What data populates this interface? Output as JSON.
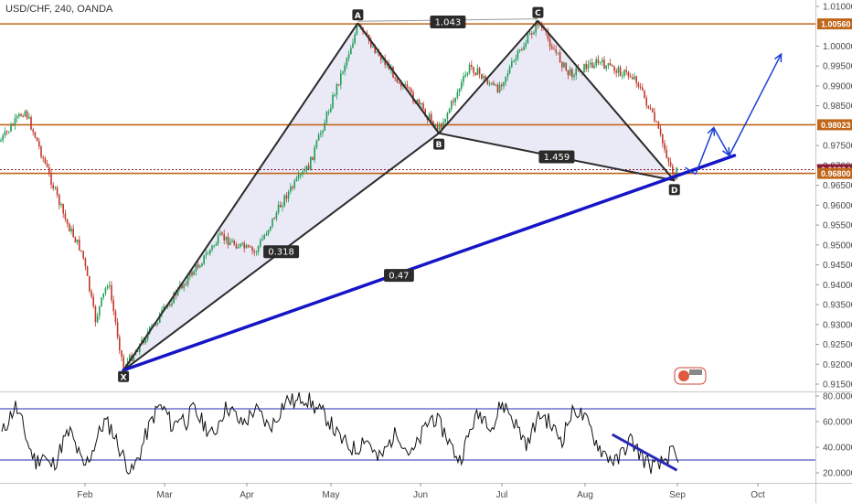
{
  "title": "USD/CHF, 240, OANDA",
  "colors": {
    "pattern_line": "#2b2b2b",
    "pattern_fill": "#d8d8f0",
    "trendline": "#1515c8",
    "projection": "#1a3fd6",
    "resistance": "#c0661a",
    "current": "#8b1a3a",
    "candle_up": "#1f9d55",
    "candle_down": "#c0392b",
    "rsi_line": "#111111",
    "rsi_levels": "#2a2ab8"
  },
  "chart_data": [
    {
      "type": "candlestick",
      "title": "USD/CHF, 240, OANDA",
      "x_tick_labels": [
        "Feb",
        "Mar",
        "Apr",
        "May",
        "Jun",
        "Jul",
        "Aug",
        "Sep",
        "Oct"
      ],
      "y_tick_labels": [
        "1.01000",
        "1.00000",
        "0.99500",
        "0.99000",
        "0.98500",
        "0.97500",
        "0.97000",
        "0.96500",
        "0.96000",
        "0.95500",
        "0.95000",
        "0.94500",
        "0.94000",
        "0.93500",
        "0.93000",
        "0.92500",
        "0.92000",
        "0.91500"
      ],
      "ylim": [
        0.9135,
        1.0113
      ],
      "y_ticks_values": [
        1.01,
        1.0,
        0.995,
        0.99,
        0.985,
        0.975,
        0.97,
        0.965,
        0.96,
        0.955,
        0.95,
        0.945,
        0.94,
        0.935,
        0.93,
        0.925,
        0.92,
        0.915
      ],
      "horizontal_levels": [
        {
          "label": "1.00560",
          "value": 1.0056,
          "color": "#c0661a"
        },
        {
          "label": "0.98023",
          "value": 0.98023,
          "color": "#c0661a"
        },
        {
          "label": "0.96894",
          "value": 0.96894,
          "color": "#8b1a3a"
        },
        {
          "label": "0.96800",
          "value": 0.968,
          "color": "#c0661a"
        }
      ],
      "pattern_points": [
        {
          "name": "X",
          "date": "2017-02-16",
          "price": 0.9185
        },
        {
          "name": "A",
          "date": "2017-05-10",
          "price": 1.0058
        },
        {
          "name": "B",
          "date": "2017-06-08",
          "price": 0.9781
        },
        {
          "name": "C",
          "date": "2017-07-14",
          "price": 1.0064
        },
        {
          "name": "D",
          "date": "2017-08-31",
          "price": 0.9662
        }
      ],
      "ratios": [
        {
          "label": "1.043",
          "between": [
            "A",
            "C"
          ]
        },
        {
          "label": "0.318",
          "between": [
            "X",
            "B"
          ]
        },
        {
          "label": "1.459",
          "between": [
            "B",
            "D"
          ]
        },
        {
          "label": "0.47",
          "between": [
            "X",
            "D"
          ]
        }
      ],
      "trendline": {
        "from": {
          "date": "2017-02-16",
          "price": 0.9185
        },
        "to": {
          "date": "2017-09-23",
          "price": 0.9725
        }
      },
      "projection_path": [
        {
          "date": "2017-09-04",
          "price": 0.9695
        },
        {
          "date": "2017-09-08",
          "price": 0.9678
        },
        {
          "date": "2017-09-15",
          "price": 0.9795
        },
        {
          "date": "2017-09-21",
          "price": 0.9725
        },
        {
          "date": "2017-10-10",
          "price": 0.998
        }
      ]
    },
    {
      "type": "line",
      "title": "",
      "y_tick_labels": [
        "80.0000",
        "60.0000",
        "40.0000",
        "20.0000"
      ],
      "ylim": [
        13,
        85
      ],
      "levels": [
        70,
        30
      ],
      "series": [
        {
          "values": [
            50,
            62,
            72,
            58,
            40,
            28,
            35,
            25,
            30,
            45,
            52,
            38,
            24,
            34,
            48,
            60,
            55,
            42,
            30,
            20,
            32,
            48,
            62,
            72,
            68,
            55,
            65,
            60,
            70,
            62,
            55,
            48,
            64,
            72,
            66,
            58,
            62,
            70,
            64,
            56,
            60,
            72,
            78,
            74,
            80,
            76,
            70,
            66,
            60,
            50,
            44,
            40,
            38,
            48,
            42,
            30,
            36,
            46,
            52,
            40,
            34,
            44,
            56,
            64,
            58,
            50,
            38,
            30,
            44,
            60,
            66,
            62,
            56,
            74,
            70,
            60,
            50,
            42,
            58,
            66,
            60,
            52,
            46,
            62,
            70,
            64,
            56,
            44,
            36,
            32,
            28,
            38,
            46,
            38,
            30,
            26,
            24,
            30,
            36,
            28
          ]
        }
      ],
      "trendline": {
        "from_index": 92,
        "from_value": 45,
        "to_index": 98,
        "to_value": 23
      }
    }
  ]
}
